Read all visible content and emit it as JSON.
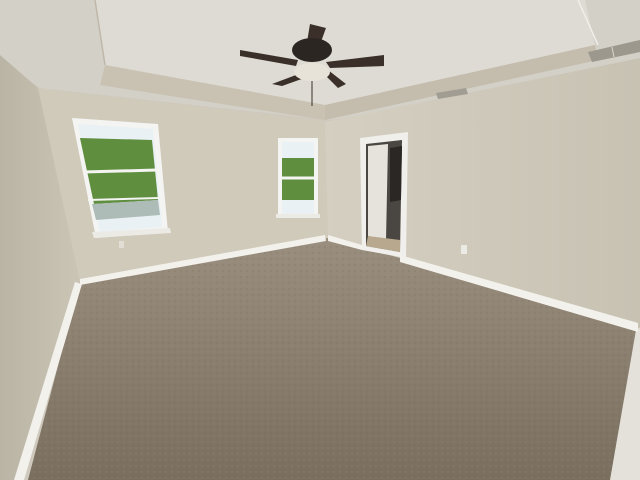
{
  "scene": {
    "colors": {
      "ceiling": "#d9d6cf",
      "trayInner": "#dedbd4",
      "trayBand": "#c9c2b3",
      "backWall": "#d2ccbd",
      "rightWall": "#cdc7b8",
      "leftWall": "#c6c0b1",
      "baseboard": "#f3f1ec",
      "carpet": "#8c8070",
      "carpetDark": "#6f6456",
      "windowFrame": "#f4f4f2",
      "foliage": "#5f8f3e",
      "sky": "#e9f1f5",
      "fanBody": "#2b2622",
      "fanBlade": "#3a3029",
      "fanLight": "#e8e3d8",
      "doorFrame": "#f0efeb",
      "doorway": "#4a4641",
      "vent": "#9d988e"
    },
    "objects": [
      "ceiling-fan",
      "left-window",
      "center-window",
      "open-door",
      "ceiling-vent",
      "wall-vent",
      "carpet-floor"
    ]
  }
}
